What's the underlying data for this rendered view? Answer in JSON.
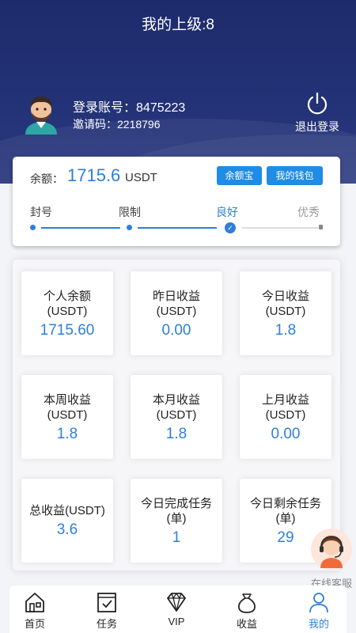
{
  "header": {
    "title": "我的上级:8"
  },
  "profile": {
    "account_label": "登录账号：",
    "account_value": "8475223",
    "invite_label": "邀请码：",
    "invite_value": "2218796",
    "logout_label": "退出登录"
  },
  "balance": {
    "label": "余额：",
    "value": "1715.6",
    "unit": "USDT",
    "buttons": [
      "余额宝",
      "我的钱包"
    ],
    "levels": [
      "封号",
      "限制",
      "良好",
      "优秀"
    ],
    "current_level": "良好"
  },
  "stats": [
    {
      "label1": "个人余额",
      "label2": "(USDT)",
      "value": "1715.60"
    },
    {
      "label1": "昨日收益",
      "label2": "(USDT)",
      "value": "0.00"
    },
    {
      "label1": "今日收益",
      "label2": "(USDT)",
      "value": "1.8"
    },
    {
      "label1": "本周收益",
      "label2": "(USDT)",
      "value": "1.8"
    },
    {
      "label1": "本月收益",
      "label2": "(USDT)",
      "value": "1.8"
    },
    {
      "label1": "上月收益",
      "label2": "(USDT)",
      "value": "0.00"
    },
    {
      "label1": "总收益(USDT)",
      "label2": "",
      "value": "3.6"
    },
    {
      "label1": "今日完成任务",
      "label2": "(单)",
      "value": "1"
    },
    {
      "label1": "今日剩余任务",
      "label2": "(单)",
      "value": "29"
    }
  ],
  "service": {
    "label": "在线客服"
  },
  "tabbar": {
    "items": [
      {
        "label": "首页",
        "icon": "home-icon"
      },
      {
        "label": "任务",
        "icon": "task-icon"
      },
      {
        "label": "VIP",
        "icon": "diamond-icon"
      },
      {
        "label": "收益",
        "icon": "money-bag-icon"
      },
      {
        "label": "我的",
        "icon": "user-icon"
      }
    ],
    "active": "我的"
  },
  "colors": {
    "header_bg": "#1e2b6b",
    "accent": "#2f7fd6",
    "button": "#1f8ce6"
  }
}
